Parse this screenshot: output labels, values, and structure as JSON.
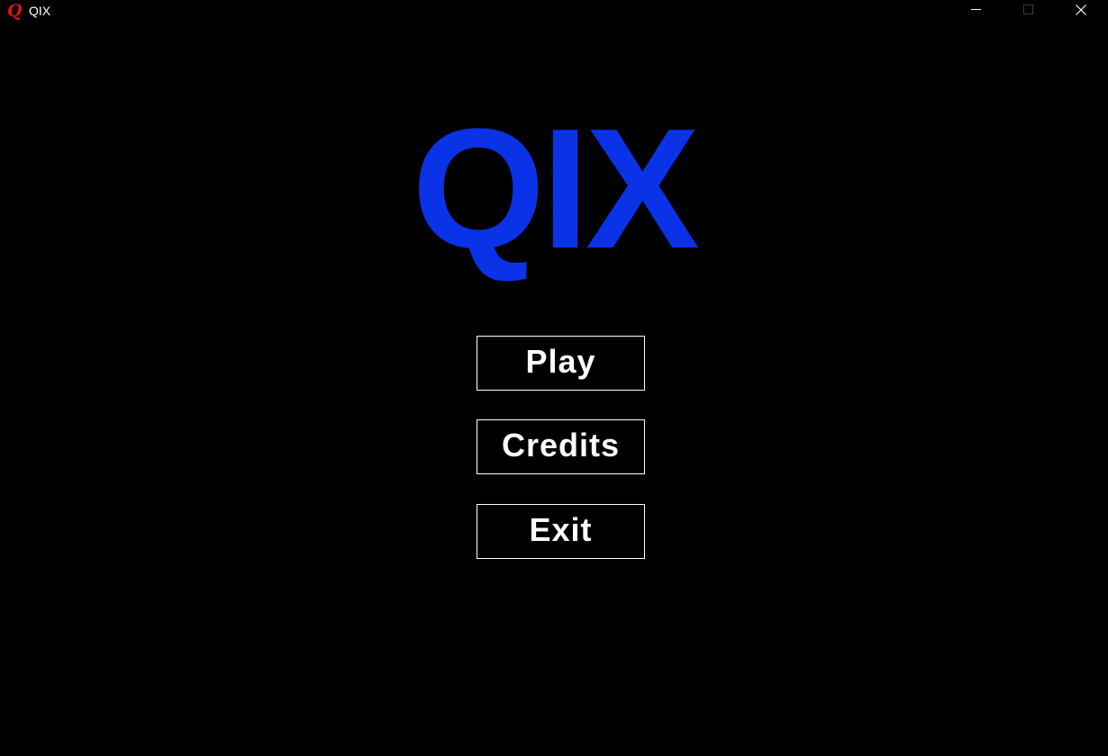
{
  "window": {
    "title": "QIX",
    "icon": "qix-app-icon",
    "icon_glyph": "Q",
    "controls": [
      "minimize-icon",
      "maximize-icon",
      "close-icon"
    ]
  },
  "game": {
    "logo_text": "QIX",
    "logo_color": "#0a32e6",
    "background_color": "#000000"
  },
  "menu": {
    "play_label": "Play",
    "credits_label": "Credits",
    "exit_label": "Exit",
    "button_border_color": "#ffffff"
  }
}
